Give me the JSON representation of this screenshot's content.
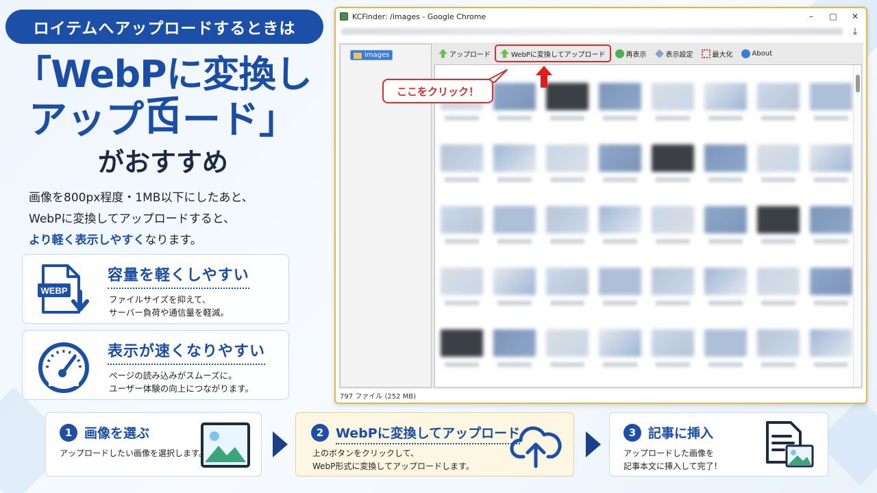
{
  "banner": {
    "pill": "ロイテムへアップロードするときは",
    "headline_line1": "「WebPに変換して",
    "headline_line2": "アップロード」",
    "headline_line3": "がおすすめ",
    "intro_line1": "画像を800px程度・1MB以下にしたあと、",
    "intro_line2": "WebPに変換してアップロードすると、",
    "intro_emph": "より軽く表示しやすく",
    "intro_tail": "なります。"
  },
  "features": [
    {
      "title": "容量を軽くしやすい",
      "badge": "WEBP",
      "desc_line1": "ファイルサイズを抑えて、",
      "desc_line2": "サーバー負荷や通信量を軽減。"
    },
    {
      "title": "表示が速くなりやすい",
      "desc_line1": "ページの読み込みがスムーズに。",
      "desc_line2": "ユーザー体験の向上につながります。"
    }
  ],
  "browser": {
    "title": "KCFinder: /images - Google Chrome",
    "win_minimize": "–",
    "win_maximize": "□",
    "win_close": "✕",
    "download_glyph": "⤓",
    "tree_folder": "images",
    "toolbar": {
      "upload": "アップロード",
      "webp_upload": "WebPに変換してアップロード",
      "refresh": "再表示",
      "view_settings": "表示設定",
      "maximize": "最大化",
      "about": "About"
    },
    "status": "797 ファイル (252 MB)",
    "callout": "ここをクリック！"
  },
  "steps": [
    {
      "num": "1",
      "title": "画像を選ぶ",
      "desc_line1": "アップロードしたい画像を選択します。",
      "desc_line2": ""
    },
    {
      "num": "2",
      "title": "WebPに変換してアップロード",
      "desc_line1": "上のボタンをクリックして、",
      "desc_line2": "WebP形式に変換してアップロードします。"
    },
    {
      "num": "3",
      "title": "記事に挿入",
      "desc_line1": "アップロードした画像を",
      "desc_line2": "記事本文に挿入して完了！"
    }
  ],
  "colors": {
    "brand_blue": "#1b4fa8",
    "highlight_red": "#d62d2d",
    "window_border": "#e3b83a",
    "step2_bg": "#fdf6e2"
  }
}
